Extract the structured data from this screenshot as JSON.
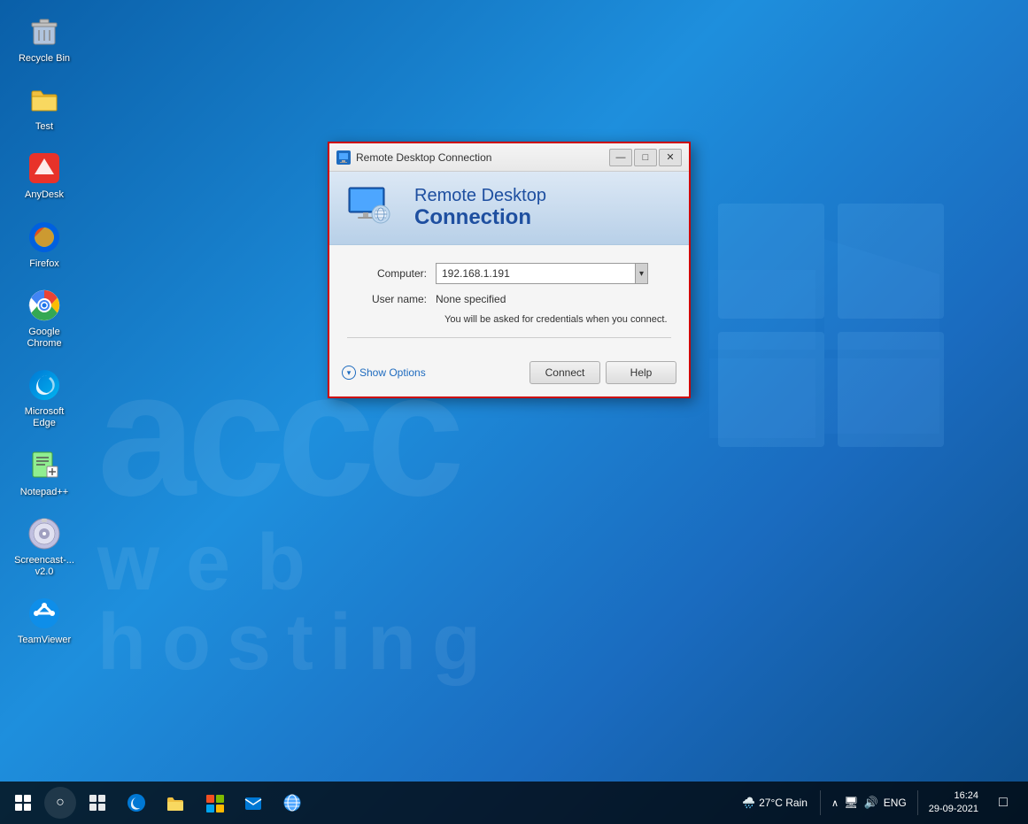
{
  "desktop": {
    "icons": [
      {
        "id": "recycle-bin",
        "label": "Recycle Bin",
        "icon": "🗑️"
      },
      {
        "id": "test",
        "label": "Test",
        "icon": "📁"
      },
      {
        "id": "anydesk",
        "label": "AnyDesk",
        "icon": "🔴"
      },
      {
        "id": "firefox",
        "label": "Firefox",
        "icon": "🦊"
      },
      {
        "id": "google-chrome",
        "label": "Google Chrome",
        "icon": "🌐"
      },
      {
        "id": "microsoft-edge",
        "label": "Microsoft Edge",
        "icon": "🌀"
      },
      {
        "id": "notepadpp",
        "label": "Notepad++",
        "icon": "📝"
      },
      {
        "id": "screencast",
        "label": "Screencast-... v2.0",
        "icon": "💿"
      },
      {
        "id": "teamviewer",
        "label": "TeamViewer",
        "icon": "🔁"
      }
    ],
    "watermark_lines": [
      "accc",
      "web  hosting"
    ]
  },
  "rdp_dialog": {
    "title": "Remote Desktop Connection",
    "header_line1": "Remote Desktop",
    "header_line2": "Connection",
    "fields": {
      "computer_label": "Computer:",
      "computer_value": "192.168.1.191",
      "username_label": "User name:",
      "username_value": "None specified",
      "info_text": "You will be asked for credentials when you connect."
    },
    "show_options_label": "Show Options",
    "connect_label": "Connect",
    "help_label": "Help"
  },
  "taskbar": {
    "weather": "27°C  Rain",
    "language": "ENG",
    "time": "16:24",
    "date": "29-09-2021"
  },
  "window_controls": {
    "minimize": "—",
    "maximize": "□",
    "close": "✕"
  }
}
